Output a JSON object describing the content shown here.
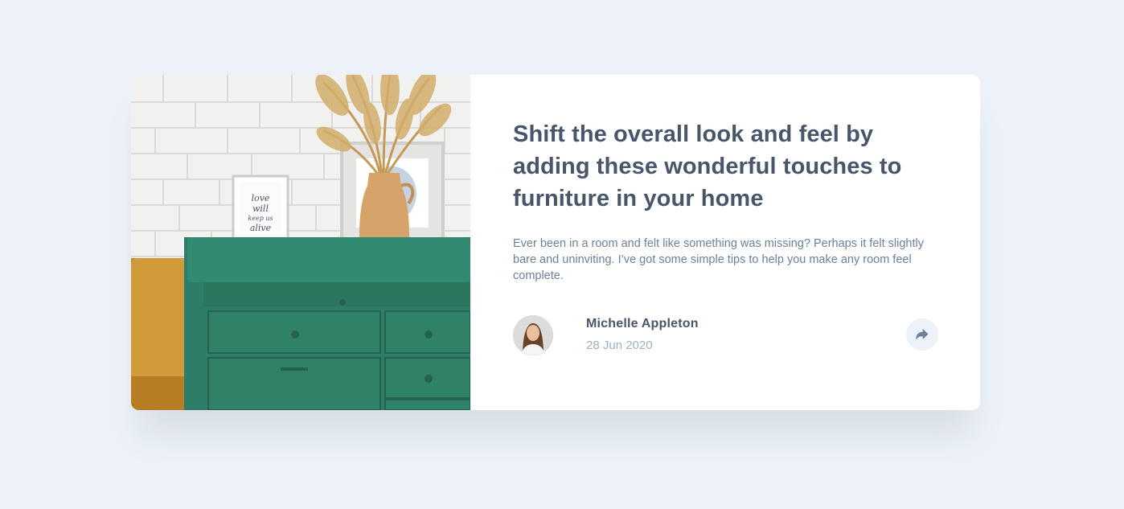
{
  "article": {
    "headline": "Shift the overall look and feel by adding these wonderful touches to furniture in your home",
    "excerpt": "Ever been in a room and felt like something was missing? Perhaps it felt slightly bare and uninviting. I’ve got some simple tips to help you make any room feel complete.",
    "image": {
      "subject": "drawers-photo",
      "frame_text": "love will keep us alive"
    }
  },
  "author": {
    "name": "Michelle Appleton",
    "date": "28 Jun 2020",
    "avatar_icon": "avatar-photo"
  },
  "share": {
    "icon": "share-arrow-icon"
  },
  "colors": {
    "background": "#ecf2f8",
    "card": "#ffffff",
    "heading": "#48556a",
    "body_text": "#6e8098",
    "muted": "#9eafc2",
    "share_bg": "#ecf2f8",
    "share_icon": "#6e8098"
  }
}
